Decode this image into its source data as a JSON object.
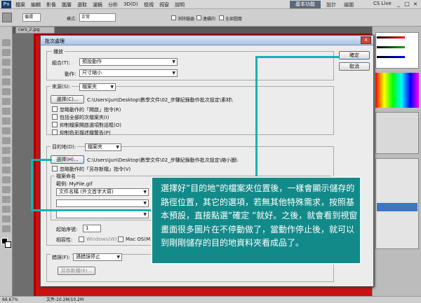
{
  "app": {
    "logo": "Ps",
    "menus": [
      "檔案",
      "編輯",
      "影像",
      "圖層",
      "選取",
      "濾鏡",
      "分析",
      "3D(D)",
      "檢視",
      "視窗",
      "說明"
    ],
    "workspace_active": "基本功能",
    "workspace_links": [
      "設計",
      "繪圖"
    ],
    "cs_live": "CS Live",
    "win_controls": [
      "_",
      "□",
      "×"
    ]
  },
  "options_bar": {
    "mode_label": "模式:",
    "mode_value": "正常",
    "tab_value": "循環",
    "anti_alias": "消除鋸齒",
    "contiguous": "連續的",
    "all_layers": "全部圖層"
  },
  "document": {
    "tab": "cars_2.jpg",
    "zoom": "66.67%",
    "file_info": "文件:10.2M/10.2M"
  },
  "dialog": {
    "title": "批次處理",
    "ok": "確定",
    "cancel": "取消",
    "play": {
      "title": "播放",
      "set_label": "組合(T):",
      "set_value": "預設動作",
      "action_label": "動作:",
      "action_value": "尺寸縮小"
    },
    "source": {
      "label": "來源(S):",
      "value": "檔案夾",
      "choose_button": "選擇(C)...",
      "path": "C:\\Users\\jun\\Desktop\\數學文件\\02_步驟紀錄動作批次設定\\素材\\",
      "options": [
        "忽略動作的「開啟」指令(R)",
        "包括全部的次檔案夾(I)",
        "抑制檔案開啟選項對話框(O)",
        "抑制色彩描述檔警告(P)"
      ]
    },
    "destination": {
      "label": "目的地(D):",
      "value": "檔案夾",
      "choose_button": "選擇(H)...",
      "path": "C:\\Users\\jun\\Desktop\\數學文件\\02_步驟紀錄動作批次設定\\縮小圖\\",
      "override_save": "忽略動作的「另存新檔」指令(V)",
      "naming_title": "檔案命名",
      "example": "範例: MyFile.gif",
      "name_field": "文件名稱 (外文首字大寫)",
      "serial_label": "起始序號:",
      "serial_value": "1",
      "compat_label": "相容性:",
      "compat_windows": "Windows(W)",
      "compat_mac": "Mac OS(M)"
    },
    "errors": {
      "label": "錯誤(F):",
      "value": "遇錯誤停止",
      "save_as_button": "另存新檔(E)..."
    }
  },
  "callout": {
    "text": "選擇好”目的地”的檔案夾位置後，一樣會顯示儲存的路徑位置，其它的選項，若無其他特殊需求，按照基本預設，直接點選”確定 ”就好。之後，就會看到視窗畫面很多圖片在不停動做了，當動作停止後，就可以到剛剛儲存的目的地資料夾看成品了。"
  },
  "colors": {
    "callout_bg": "#138a8a",
    "callout_line": "#15b3b3",
    "image_border": "#cc1111"
  }
}
